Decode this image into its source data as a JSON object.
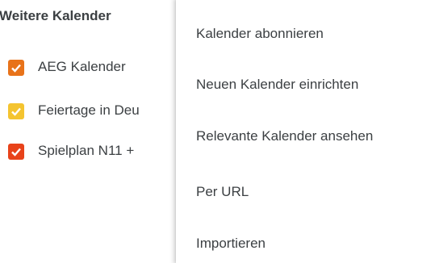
{
  "sidebar": {
    "section_title": "Weitere Kalender",
    "calendars": [
      {
        "label": "AEG Kalender",
        "color": "#e8731a"
      },
      {
        "label": "Feiertage in Deu",
        "color": "#f4c430"
      },
      {
        "label": "Spielplan N11 +",
        "color": "#e8431a"
      }
    ]
  },
  "menu": {
    "items": [
      {
        "label": "Kalender abonnieren"
      },
      {
        "label": "Neuen Kalender einrichten"
      },
      {
        "label": "Relevante Kalender ansehen"
      },
      {
        "label": "Per URL"
      },
      {
        "label": "Importieren"
      }
    ]
  }
}
